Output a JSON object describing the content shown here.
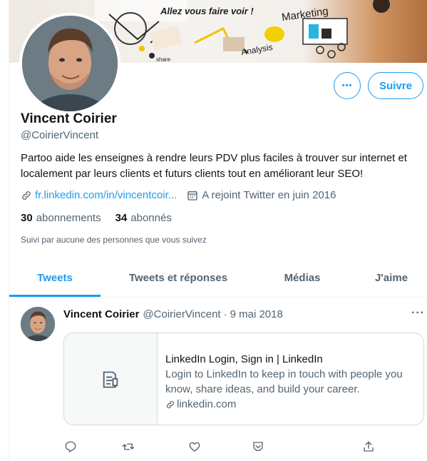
{
  "banner": {
    "texts": {
      "tagline": "Allez vous faire voir !",
      "marketing": "Marketing",
      "analysis": "Analysis",
      "share": "share"
    }
  },
  "profile": {
    "name": "Vincent Coirier",
    "handle": "@CoirierVincent",
    "bio": "Partoo aide les enseignes à rendre leurs PDV plus faciles à trouver sur internet et localement par leurs clients et futurs clients tout en améliorant leur SEO!",
    "website": "fr.linkedin.com/in/vincentcoir...",
    "joined": "A rejoint Twitter en juin 2016",
    "following_count": "30",
    "following_label": "abonnements",
    "followers_count": "34",
    "followers_label": "abonnés",
    "followed_by": "Suivi par aucune des personnes que vous suivez"
  },
  "actions": {
    "more": "•••",
    "follow": "Suivre"
  },
  "tabs": [
    {
      "label": "Tweets",
      "active": true
    },
    {
      "label": "Tweets et réponses",
      "active": false
    },
    {
      "label": "Médias",
      "active": false
    },
    {
      "label": "J'aime",
      "active": false
    }
  ],
  "tweet": {
    "author": "Vincent Coirier",
    "handle": "@CoirierVincent",
    "separator": "·",
    "date": "9 mai 2018",
    "more": "···",
    "card": {
      "title": "LinkedIn Login, Sign in | LinkedIn",
      "description": "Login to LinkedIn to keep in touch with people you know, share ideas, and build your career.",
      "domain": "linkedin.com"
    },
    "action_icons": [
      "reply-icon",
      "retweet-icon",
      "like-icon",
      "bookmark-icon",
      "share-icon"
    ]
  },
  "colors": {
    "accent": "#1d9bf0",
    "text": "#0f1419",
    "muted": "#536471",
    "border": "#cfd9de"
  }
}
